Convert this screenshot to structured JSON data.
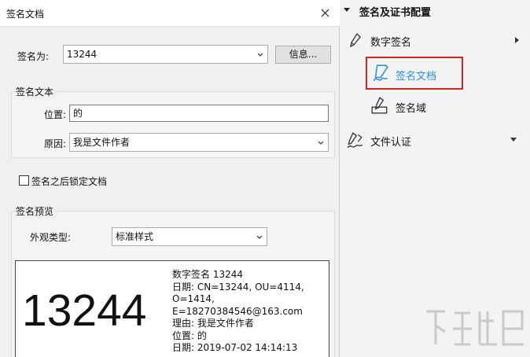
{
  "dialog": {
    "title": "签名文档",
    "sign_as_label": "签名为:",
    "sign_as_value": "13244",
    "info_button": "信息...",
    "sign_text_group": "签名文本",
    "location_label": "位置:",
    "location_value": "的",
    "reason_label": "原因:",
    "reason_value": "我是文件作者",
    "lock_checkbox_label": "签名之后锁定文档",
    "lock_checked": false,
    "preview_group": "签名预览",
    "appearance_label": "外观类型:",
    "appearance_value": "标准样式"
  },
  "preview": {
    "big_name": "13244",
    "lines": [
      "数字签名 13244",
      "日期: CN=13244, OU=4114,",
      "O=1414,",
      "E=18270384546@163.com",
      "理由: 我是文件作者",
      "位置: 的",
      "日期: 2019-07-02 14:14:13"
    ]
  },
  "pane": {
    "title": "签名及证书配置",
    "items": [
      {
        "label": "数字签名",
        "icon": "pen-nib-icon"
      },
      {
        "label": "签名文档",
        "icon": "sign-document-icon"
      },
      {
        "label": "签名域",
        "icon": "signature-field-icon"
      },
      {
        "label": "文件认证",
        "icon": "certify-document-icon"
      }
    ]
  },
  "colors": {
    "accent": "#2b8fd6",
    "highlight": "#d7261c"
  }
}
